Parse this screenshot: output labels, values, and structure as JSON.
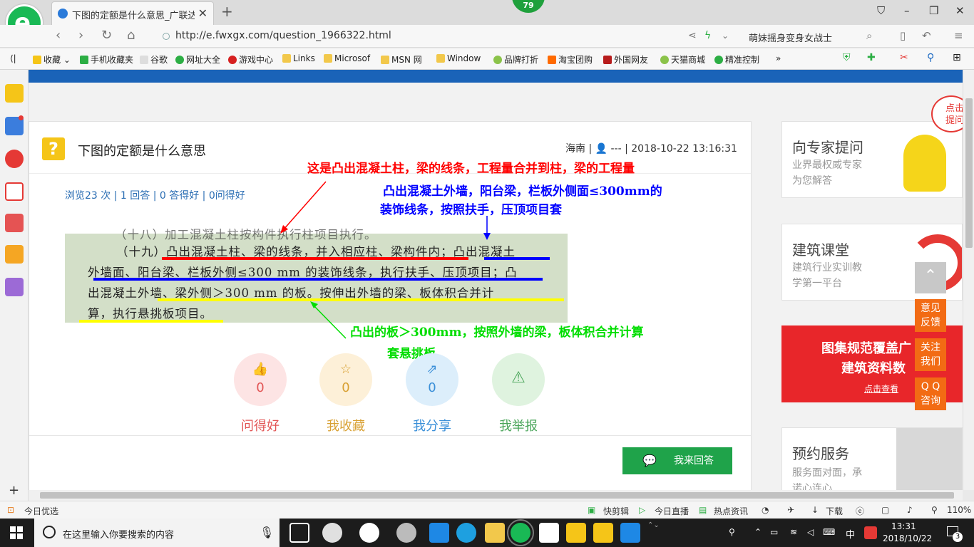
{
  "browser": {
    "tab_title": "下图的定额是什么意思_广联达服",
    "new_tab": "+",
    "badge": "79",
    "url": "http://e.fwxgx.com/question_1966322.html",
    "search_value": "萌妹摇身变身女战士",
    "bookmarks": [
      "收藏",
      "手机收藏夹",
      "谷歌",
      "网址大全",
      "游戏中心",
      "Links",
      "Microsof",
      "MSN 网",
      "Window",
      "品牌打折",
      "淘宝团购",
      "外国网友",
      "天猫商城",
      "精准控制"
    ]
  },
  "question": {
    "icon": "?",
    "title": "下图的定额是什么意思",
    "meta": "海南 | 👤 --- | 2018-10-22 13:16:31",
    "stats": "浏览23 次 | 1 回答 | 0 答得好 | 0问得好",
    "image_lines": [
      "（十八）加工混凝土柱按构件执行柱项目执行。",
      "（十九）凸出混凝土柱、梁的线条，并入相应柱、梁构件内；凸出混凝土",
      "外墙面、阳台梁、栏板外侧≤300 mm 的装饰线条，执行扶手、压顶项目；凸",
      "出混凝土外墙、梁外侧＞300 mm 的板。按伸出外墙的梁、板体积合并计",
      "算，执行悬挑板项目。"
    ],
    "annotations": {
      "red": "这是凸出混凝土柱，梁的线条，工程量合并到柱，梁的工程量",
      "blue_1": "凸出混凝土外墙，阳台梁，栏板外侧面≤300mm的",
      "blue_2": "装饰线条，按照扶手，压顶项目套",
      "green_1": "凸出的板＞300mm，按照外墙的梁，板体积合并计算",
      "green_2": "套悬挑板"
    },
    "colors": {
      "red": "#ff0000",
      "blue": "#0000ff",
      "green": "#00dd00",
      "yellow": "#ffff00"
    }
  },
  "actions": [
    {
      "icon": "thumbs-up-icon",
      "glyph": "👍",
      "count": "0",
      "label": "问得好",
      "color": "#e25555",
      "bg": "#fde4e4"
    },
    {
      "icon": "star-icon",
      "glyph": "☆",
      "count": "0",
      "label": "我收藏",
      "color": "#d8a032",
      "bg": "#fdf0d8"
    },
    {
      "icon": "share-icon",
      "glyph": "⇗",
      "count": "0",
      "label": "我分享",
      "color": "#3a8fd8",
      "bg": "#dceefb"
    },
    {
      "icon": "warning-icon",
      "glyph": "⚠",
      "count": "",
      "label": "我举报",
      "color": "#4aa55a",
      "bg": "#dff3df"
    }
  ],
  "answer_button": "我来回答",
  "right": {
    "expert": {
      "title": "向专家提问",
      "sub1": "业界最权威专家",
      "sub2": "为您解答"
    },
    "course": {
      "title": "建筑课堂",
      "sub1": "建筑行业实训教",
      "sub2": "学第一平台"
    },
    "banner": {
      "line1": "图集规范覆盖广",
      "line2": "建筑资料数",
      "btn": "点击查看"
    },
    "booking": {
      "title": "预约服务",
      "sub1": "服务面对面，承",
      "sub2": "诺心连心"
    },
    "float_buttons": [
      "意见\n反馈",
      "关注\n我们",
      "Q Q\n咨询"
    ],
    "corner_tag": "点击\n提问"
  },
  "status": [
    "今日优选",
    "快剪辑",
    "今日直播",
    "热点资讯",
    "下载",
    "110%"
  ],
  "taskbar": {
    "search_placeholder": "在这里输入你要搜索的内容",
    "ime": "中",
    "time": "13:31",
    "date": "2018/10/22",
    "notif": "3"
  }
}
